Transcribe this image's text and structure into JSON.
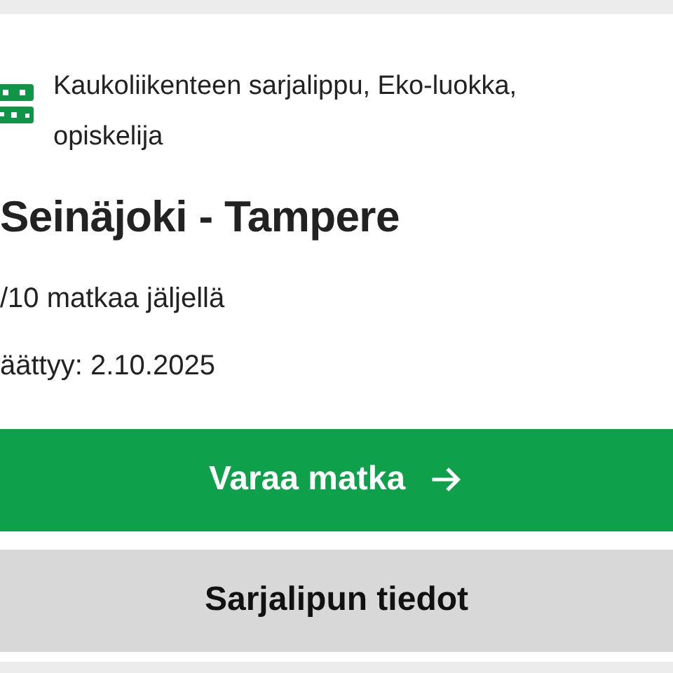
{
  "ticket": {
    "type": "Kaukoliikenteen sarjalippu, Eko-luokka, opiskelija",
    "route": "Seinäjoki - Tampere",
    "remaining": "/10 matkaa jäljellä",
    "expires": "äättyy: 2.10.2025"
  },
  "buttons": [
    {
      "label": "Varaa matka",
      "kind": "primary",
      "arrow": true
    },
    {
      "label": "Sarjalipun tiedot",
      "kind": "secondary",
      "arrow": false
    }
  ]
}
